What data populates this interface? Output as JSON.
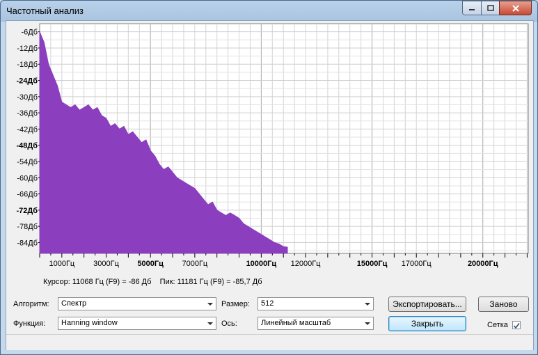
{
  "window": {
    "title": "Частотный анализ"
  },
  "chart_data": {
    "type": "area",
    "color": "#8b3fbf",
    "y_tick_labels": [
      "-6Дб",
      "-12Дб",
      "-18Дб",
      "-24Дб",
      "-30Дб",
      "-36Дб",
      "-42Дб",
      "-48Дб",
      "-54Дб",
      "-60Дб",
      "-66Дб",
      "-72Дб",
      "-78Дб",
      "-84Дб"
    ],
    "y_bold_labels": [
      "-24Дб",
      "-48Дб",
      "-72Дб"
    ],
    "x_tick_labels": [
      "1000Гц",
      "3000Гц",
      "5000Гц",
      "7000Гц",
      "10000Гц",
      "12000Гц",
      "15000Гц",
      "17000Гц",
      "20000Гц"
    ],
    "x_bold_labels": [
      "5000Гц",
      "10000Гц",
      "15000Гц",
      "20000Гц"
    ],
    "grid": true,
    "x_unit": "Гц",
    "y_unit": "Дб",
    "x": [
      0,
      200,
      400,
      600,
      800,
      1000,
      1200,
      1400,
      1600,
      1800,
      2000,
      2200,
      2400,
      2600,
      2800,
      3000,
      3200,
      3400,
      3600,
      3800,
      4000,
      4200,
      4400,
      4600,
      4800,
      5000,
      5200,
      5400,
      5600,
      5800,
      6000,
      6200,
      6400,
      6600,
      6800,
      7000,
      7200,
      7400,
      7600,
      7800,
      8000,
      8200,
      8400,
      8600,
      8800,
      9000,
      9200,
      9400,
      9600,
      9800,
      10000,
      10200,
      10400,
      10600,
      10800,
      11000,
      11181
    ],
    "y": [
      -6,
      -10,
      -18,
      -22,
      -26,
      -32,
      -33,
      -34,
      -33,
      -35,
      -34,
      -33,
      -35,
      -34,
      -37,
      -38,
      -41,
      -40,
      -42,
      -41,
      -44,
      -43,
      -45,
      -47,
      -46,
      -50,
      -52,
      -55,
      -57,
      -56,
      -58,
      -60,
      -61,
      -62,
      -63,
      -64,
      -66,
      -68,
      -70,
      -69,
      -72,
      -73,
      -74,
      -73,
      -74,
      -75,
      -77,
      -78,
      -79,
      -80,
      -81,
      -82,
      -83,
      -84,
      -84.5,
      -85.5,
      -85.7
    ]
  },
  "info": {
    "cursor": "Курсор: 11068 Гц (F9) = -86 Дб",
    "peak": "Пик: 11181 Гц (F9) = -85,7 Дб"
  },
  "controls": {
    "algorithm_label": "Алгоритм:",
    "algorithm_value": "Спектр",
    "function_label": "Функция:",
    "function_value": "Hanning window",
    "size_label": "Размер:",
    "size_value": "512",
    "axis_label": "Ось:",
    "axis_value": "Линейный масштаб",
    "export_label": "Экспортировать...",
    "replot_label": "Заново",
    "close_label": "Закрыть",
    "grid_label": "Сетка",
    "grid_checked": true
  }
}
